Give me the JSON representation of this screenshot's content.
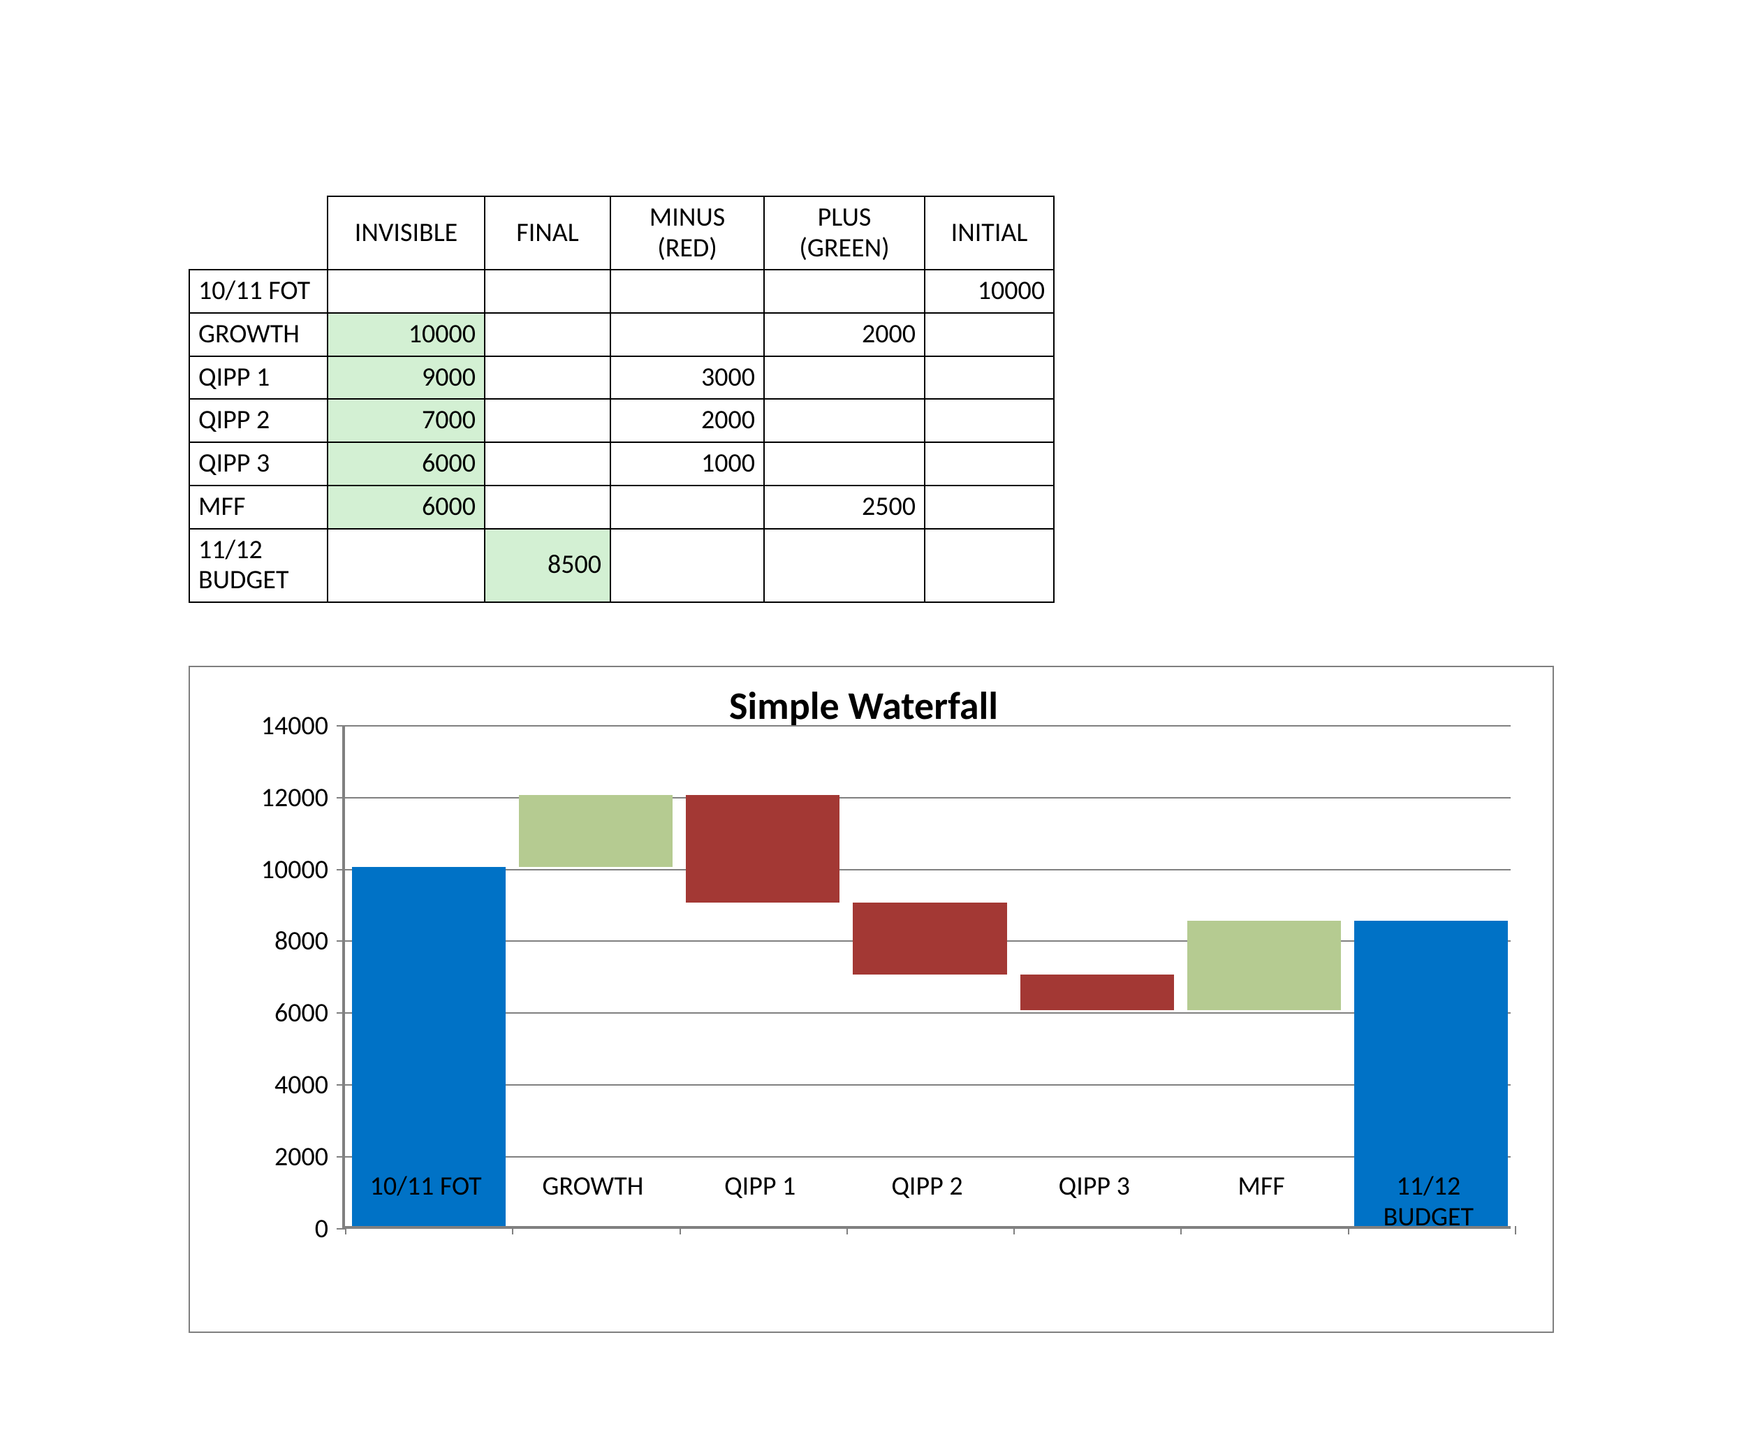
{
  "table": {
    "headers": [
      "INVISIBLE",
      "FINAL",
      "MINUS (RED)",
      "PLUS (GREEN)",
      "INITIAL"
    ],
    "header_split": [
      [
        "INVISIBLE"
      ],
      [
        "FINAL"
      ],
      [
        "MINUS",
        "(RED)"
      ],
      [
        "PLUS",
        "(GREEN)"
      ],
      [
        "INITIAL"
      ]
    ],
    "rows": [
      {
        "label": "10/11 FOT",
        "invisible": "",
        "final": "",
        "minus": "",
        "plus": "",
        "initial": "10000"
      },
      {
        "label": "GROWTH",
        "invisible": "10000",
        "final": "",
        "minus": "",
        "plus": "2000",
        "initial": ""
      },
      {
        "label": "QIPP 1",
        "invisible": "9000",
        "final": "",
        "minus": "3000",
        "plus": "",
        "initial": ""
      },
      {
        "label": "QIPP 2",
        "invisible": "7000",
        "final": "",
        "minus": "2000",
        "plus": "",
        "initial": ""
      },
      {
        "label": "QIPP 3",
        "invisible": "6000",
        "final": "",
        "minus": "1000",
        "plus": "",
        "initial": ""
      },
      {
        "label": "MFF",
        "invisible": "6000",
        "final": "",
        "minus": "",
        "plus": "2500",
        "initial": ""
      },
      {
        "label": "11/12 BUDGET",
        "invisible": "",
        "final": "8500",
        "minus": "",
        "plus": "",
        "initial": ""
      }
    ],
    "highlight_cells": [
      {
        "row": 1,
        "col": "invisible"
      },
      {
        "row": 2,
        "col": "invisible"
      },
      {
        "row": 3,
        "col": "invisible"
      },
      {
        "row": 4,
        "col": "invisible"
      },
      {
        "row": 5,
        "col": "invisible"
      },
      {
        "row": 6,
        "col": "final"
      }
    ]
  },
  "chart_data": {
    "type": "bar",
    "subtype": "waterfall",
    "title": "Simple Waterfall",
    "xlabel": "",
    "ylabel": "",
    "ylim": [
      0,
      14000
    ],
    "y_ticks": [
      0,
      2000,
      4000,
      6000,
      8000,
      10000,
      12000,
      14000
    ],
    "categories": [
      "10/11 FOT",
      "GROWTH",
      "QIPP 1",
      "QIPP 2",
      "QIPP 3",
      "MFF",
      "11/12 BUDGET"
    ],
    "categories_split": [
      [
        "10/11 FOT"
      ],
      [
        "GROWTH"
      ],
      [
        "QIPP 1"
      ],
      [
        "QIPP 2"
      ],
      [
        "QIPP 3"
      ],
      [
        "MFF"
      ],
      [
        "11/12",
        "BUDGET"
      ]
    ],
    "series": [
      {
        "name": "INVISIBLE",
        "role": "invisible",
        "values": [
          0,
          10000,
          9000,
          7000,
          6000,
          6000,
          0
        ]
      },
      {
        "name": "INITIAL",
        "role": "initial",
        "values": [
          10000,
          0,
          0,
          0,
          0,
          0,
          0
        ]
      },
      {
        "name": "FINAL",
        "role": "final",
        "values": [
          0,
          0,
          0,
          0,
          0,
          0,
          8500
        ]
      },
      {
        "name": "PLUS (GREEN)",
        "role": "plus",
        "values": [
          0,
          2000,
          0,
          0,
          0,
          2500,
          0
        ]
      },
      {
        "name": "MINUS (RED)",
        "role": "minus",
        "values": [
          0,
          0,
          3000,
          2000,
          1000,
          0,
          0
        ]
      }
    ],
    "colors": {
      "initial": "#0072c6",
      "final": "#0072c6",
      "plus": "#b5cb91",
      "minus": "#a33834"
    }
  }
}
